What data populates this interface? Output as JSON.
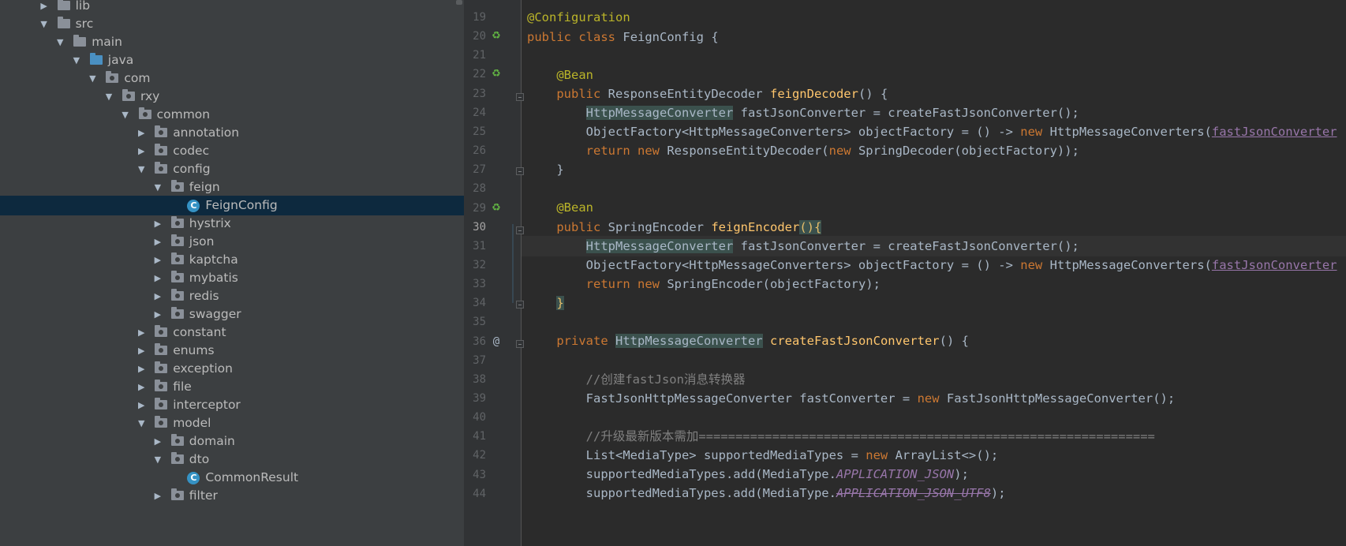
{
  "project_tree": {
    "items": [
      {
        "label": "lib",
        "expanded": false,
        "icon": "folder-icon"
      },
      {
        "label": "src",
        "expanded": true,
        "icon": "folder-icon"
      },
      {
        "label": "main",
        "expanded": true,
        "icon": "folder-icon"
      },
      {
        "label": "java",
        "expanded": true,
        "icon": "source-folder-icon"
      },
      {
        "label": "com",
        "expanded": true,
        "icon": "package-icon"
      },
      {
        "label": "rxy",
        "expanded": true,
        "icon": "package-icon"
      },
      {
        "label": "common",
        "expanded": true,
        "icon": "package-icon"
      },
      {
        "label": "annotation",
        "expanded": false,
        "icon": "package-icon"
      },
      {
        "label": "codec",
        "expanded": false,
        "icon": "package-icon"
      },
      {
        "label": "config",
        "expanded": true,
        "icon": "package-icon"
      },
      {
        "label": "feign",
        "expanded": true,
        "icon": "package-icon"
      },
      {
        "label": "FeignConfig",
        "icon": "java-class-icon",
        "selected": true
      },
      {
        "label": "hystrix",
        "expanded": false,
        "icon": "package-icon"
      },
      {
        "label": "json",
        "expanded": false,
        "icon": "package-icon"
      },
      {
        "label": "kaptcha",
        "expanded": false,
        "icon": "package-icon"
      },
      {
        "label": "mybatis",
        "expanded": false,
        "icon": "package-icon"
      },
      {
        "label": "redis",
        "expanded": false,
        "icon": "package-icon"
      },
      {
        "label": "swagger",
        "expanded": false,
        "icon": "package-icon"
      },
      {
        "label": "constant",
        "expanded": false,
        "icon": "package-icon"
      },
      {
        "label": "enums",
        "expanded": false,
        "icon": "package-icon"
      },
      {
        "label": "exception",
        "expanded": false,
        "icon": "package-icon"
      },
      {
        "label": "file",
        "expanded": false,
        "icon": "package-icon"
      },
      {
        "label": "interceptor",
        "expanded": false,
        "icon": "package-icon"
      },
      {
        "label": "model",
        "expanded": true,
        "icon": "package-icon"
      },
      {
        "label": "domain",
        "expanded": false,
        "icon": "package-icon"
      },
      {
        "label": "dto",
        "expanded": true,
        "icon": "package-icon"
      },
      {
        "label": "CommonResult",
        "icon": "java-class-icon"
      },
      {
        "label": "filter",
        "expanded": false,
        "icon": "package-icon"
      }
    ]
  },
  "editor": {
    "current_line": "30",
    "lines": [
      {
        "num": "19"
      },
      {
        "num": "20",
        "gutter_icon": "spring-bean-icon"
      },
      {
        "num": "21"
      },
      {
        "num": "22",
        "gutter_icon": "spring-bean-icon"
      },
      {
        "num": "23"
      },
      {
        "num": "24"
      },
      {
        "num": "25"
      },
      {
        "num": "26"
      },
      {
        "num": "27"
      },
      {
        "num": "28"
      },
      {
        "num": "29",
        "gutter_icon": "spring-bean-icon"
      },
      {
        "num": "30"
      },
      {
        "num": "31"
      },
      {
        "num": "32"
      },
      {
        "num": "33"
      },
      {
        "num": "34"
      },
      {
        "num": "35"
      },
      {
        "num": "36",
        "gutter_icon": "at-icon"
      },
      {
        "num": "37"
      },
      {
        "num": "38"
      },
      {
        "num": "39"
      },
      {
        "num": "40"
      },
      {
        "num": "41"
      },
      {
        "num": "42"
      },
      {
        "num": "43"
      },
      {
        "num": "44"
      }
    ],
    "code": {
      "l19": {
        "ann": "@Configuration"
      },
      "l20": {
        "kw1": "public",
        "kw2": "class",
        "name": "FeignConfig",
        "rest": " {"
      },
      "l22": {
        "ann": "@Bean"
      },
      "l23": {
        "kw": "public",
        "type": "ResponseEntityDecoder",
        "fn": "feignDecoder",
        "rest": "() {"
      },
      "l24": {
        "type": "HttpMessageConverter",
        "rest": " fastJsonConverter = createFastJsonConverter();"
      },
      "l25": {
        "pre": "ObjectFactory<HttpMessageConverters> objectFactory = () -> ",
        "kw": "new",
        "mid": " HttpMessageConverters(",
        "var": "fastJsonConverter"
      },
      "l26": {
        "kw1": "return",
        "kw2": "new",
        "mid1": " ResponseEntityDecoder(",
        "kw3": "new",
        "rest": " SpringDecoder(objectFactory));"
      },
      "l27": {
        "text": "}"
      },
      "l29": {
        "ann": "@Bean"
      },
      "l30": {
        "kw": "public",
        "type": "SpringEncoder",
        "fn": "feignEncoder",
        "paren": "(){"
      },
      "l31": {
        "type": "HttpMessageConverter",
        "rest": " fastJsonConverter = createFastJsonConverter();"
      },
      "l32": {
        "pre": "ObjectFactory<HttpMessageConverters> objectFactory = () -> ",
        "kw": "new",
        "mid": " HttpMessageConverters(",
        "var": "fastJsonConverter"
      },
      "l33": {
        "kw1": "return",
        "kw2": "new",
        "rest": " SpringEncoder(objectFactory);"
      },
      "l34": {
        "text": "}"
      },
      "l36": {
        "kw": "private",
        "type": "HttpMessageConverter",
        "fn": "createFastJsonConverter",
        "rest": "() {"
      },
      "l38": {
        "comment": "//创建fastJson消息转换器"
      },
      "l39": {
        "pre": "FastJsonHttpMessageConverter fastConverter = ",
        "kw": "new",
        "rest": " FastJsonHttpMessageConverter();"
      },
      "l41": {
        "comment": "//升级最新版本需加=============================================================="
      },
      "l42": {
        "pre": "List<MediaType> supportedMediaTypes = ",
        "kw": "new",
        "rest": " ArrayList<>();"
      },
      "l43": {
        "pre": "supportedMediaTypes.add(MediaType.",
        "const": "APPLICATION_JSON",
        "rest": ");"
      },
      "l44": {
        "pre": "supportedMediaTypes.add(MediaType.",
        "const": "APPLICATION_JSON_UTF8",
        "rest": ");"
      }
    }
  },
  "colors": {
    "tree_bg": "#3c3f41",
    "editor_bg": "#2b2b2b",
    "selected_row": "#0d293e",
    "keyword": "#cc7832",
    "annotation": "#bbb529",
    "function": "#ffc66d",
    "constant": "#9876aa"
  }
}
